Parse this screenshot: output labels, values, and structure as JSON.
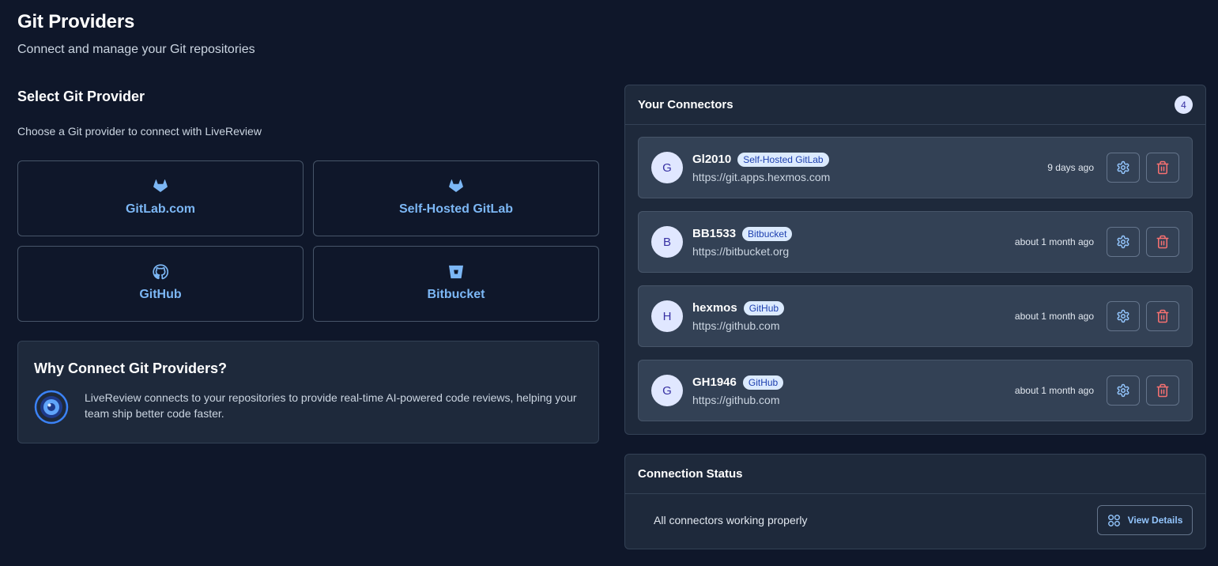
{
  "header": {
    "title": "Git Providers",
    "subtitle": "Connect and manage your Git repositories"
  },
  "select_section": {
    "title": "Select Git Provider",
    "description": "Choose a Git provider to connect with LiveReview"
  },
  "providers": [
    {
      "label": "GitLab.com",
      "icon": "gitlab-icon"
    },
    {
      "label": "Self-Hosted GitLab",
      "icon": "gitlab-icon"
    },
    {
      "label": "GitHub",
      "icon": "github-icon"
    },
    {
      "label": "Bitbucket",
      "icon": "bitbucket-icon"
    }
  ],
  "why": {
    "title": "Why Connect Git Providers?",
    "text": "LiveReview connects to your repositories to provide real-time AI-powered code reviews, helping your team ship better code faster.",
    "icon": "eye-icon"
  },
  "connectors": {
    "title": "Your Connectors",
    "count": "4",
    "items": [
      {
        "initial": "G",
        "name": "Gl2010",
        "type": "Self-Hosted GitLab",
        "url": "https://git.apps.hexmos.com",
        "time": "9 days ago"
      },
      {
        "initial": "B",
        "name": "BB1533",
        "type": "Bitbucket",
        "url": "https://bitbucket.org",
        "time": "about 1 month ago"
      },
      {
        "initial": "H",
        "name": "hexmos",
        "type": "GitHub",
        "url": "https://github.com",
        "time": "about 1 month ago"
      },
      {
        "initial": "G",
        "name": "GH1946",
        "type": "GitHub",
        "url": "https://github.com",
        "time": "about 1 month ago"
      }
    ]
  },
  "status": {
    "title": "Connection Status",
    "text": "All connectors working properly",
    "button_label": "View Details"
  },
  "colors": {
    "background": "#0f172a",
    "panel": "#1e293b",
    "accent": "#7cb7f5",
    "danger": "#f87171"
  }
}
